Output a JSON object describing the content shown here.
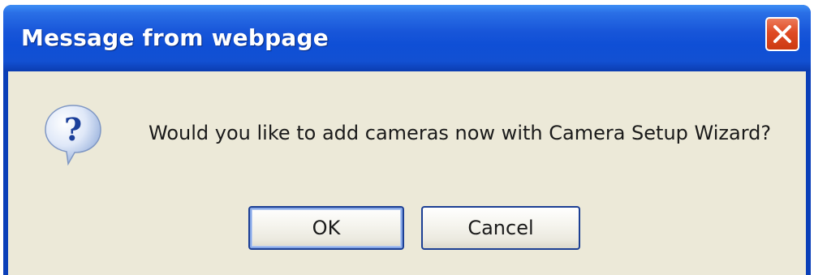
{
  "dialog": {
    "title": "Message from webpage",
    "message": "Would you like to add cameras now with Camera Setup Wizard?",
    "icon": "question-icon",
    "buttons": {
      "ok_label": "OK",
      "cancel_label": "Cancel"
    },
    "close_icon": "close-icon"
  },
  "colors": {
    "titlebar": "#1856d9",
    "body_background": "#ece9d8",
    "close_button": "#df4a24",
    "button_border": "#1c3f94"
  }
}
